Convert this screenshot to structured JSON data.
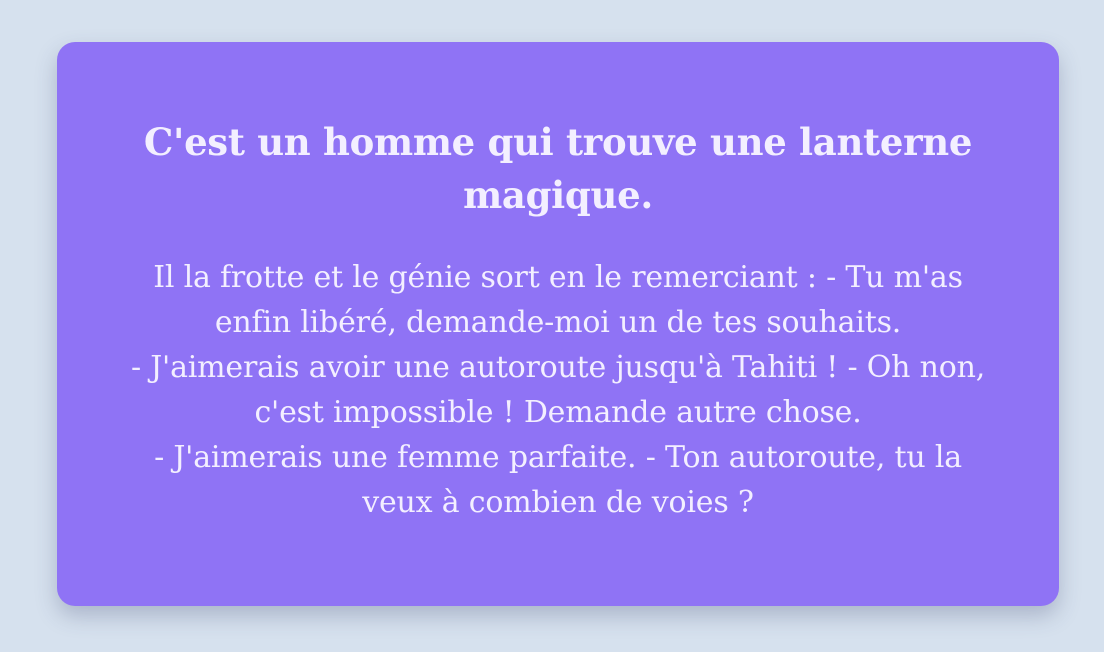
{
  "card": {
    "title": "C'est un homme qui trouve une lanterne magique.",
    "paragraphs": [
      "Il la frotte et le génie sort en le remerciant : - Tu m'as enfin libéré, demande-moi un de tes souhaits.",
      "- J'aimerais avoir une autoroute jusqu'à Tahiti ! - Oh non, c'est impossible ! Demande autre chose.",
      "- J'aimerais une femme parfaite. - Ton autoroute, tu la veux à combien de voies ?"
    ]
  },
  "colors": {
    "background": "#d6e1ee",
    "card": "#8f73f5",
    "text": "#f3efff"
  }
}
